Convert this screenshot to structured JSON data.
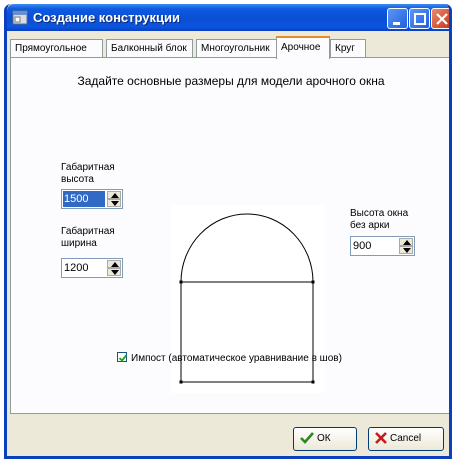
{
  "window": {
    "title": "Создание конструкции"
  },
  "tabs": [
    {
      "label": "Прямоугольное"
    },
    {
      "label": "Балконный блок"
    },
    {
      "label": "Многоугольник"
    },
    {
      "label": "Арочное",
      "active": true
    },
    {
      "label": "Круг"
    }
  ],
  "content": {
    "heading": "Задайте основные размеры для модели арочного окна",
    "height": {
      "label1": "Габаритная",
      "label2": "высота",
      "value": "1500"
    },
    "width": {
      "label1": "Габаритная",
      "label2": "ширина",
      "value": "1200"
    },
    "rect_height": {
      "label1": "Высота окна",
      "label2": "без арки",
      "value": "900"
    },
    "impost": {
      "label": "Импост (автоматическое уравнивание в шов)",
      "checked": true
    }
  },
  "buttons": {
    "ok": "ОК",
    "cancel": "Cancel"
  },
  "colors": {
    "titlebar": "#0a4fd4",
    "active_tab_accent": "#e68b2c",
    "selection": "#316ac5",
    "ok_icon": "#2a8a1e",
    "cancel_icon": "#c02020"
  }
}
